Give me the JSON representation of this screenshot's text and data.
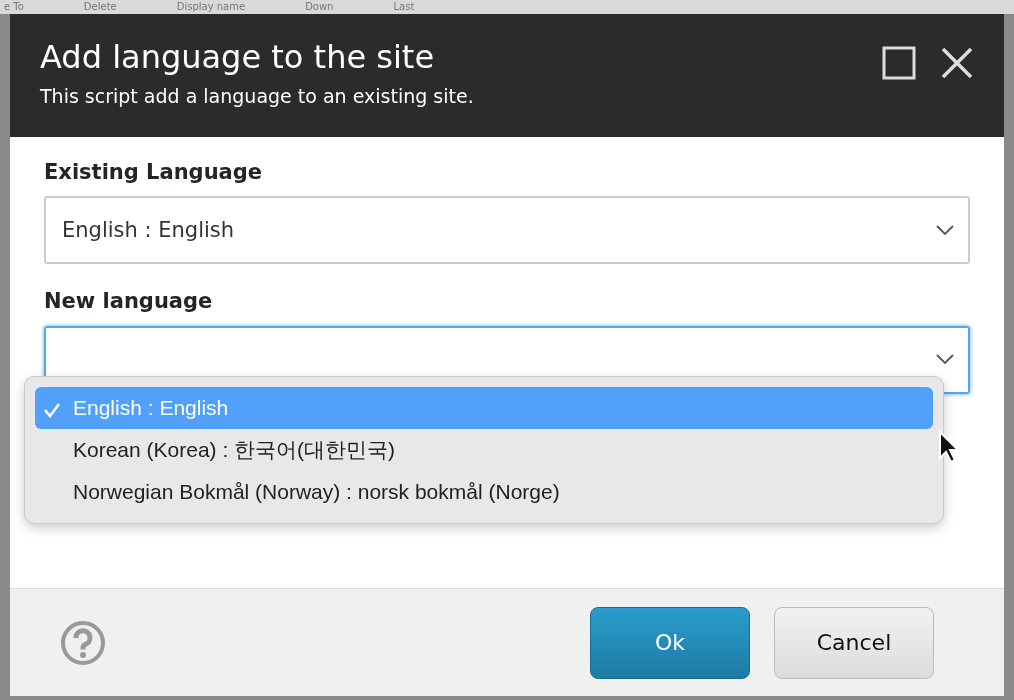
{
  "background_toolbar": [
    "e To",
    "Delete",
    "Display name",
    "Down",
    "Last"
  ],
  "dialog": {
    "title": "Add language to the site",
    "subtitle": "This script add a language to an existing site."
  },
  "fields": [
    {
      "label": "Existing Language",
      "value": "English : English",
      "focused": false
    },
    {
      "label": "New language",
      "focused": true,
      "open": true
    }
  ],
  "dropdown_options": [
    {
      "label": "English : English",
      "selected": true
    },
    {
      "label": "Korean (Korea) : 한국어(대한민국)",
      "selected": false
    },
    {
      "label": "Norwegian Bokmål (Norway) : norsk bokmål (Norge)",
      "selected": false
    }
  ],
  "buttons": [
    {
      "label": "Ok",
      "kind": "primary"
    },
    {
      "label": "Cancel",
      "kind": "secondary"
    }
  ]
}
